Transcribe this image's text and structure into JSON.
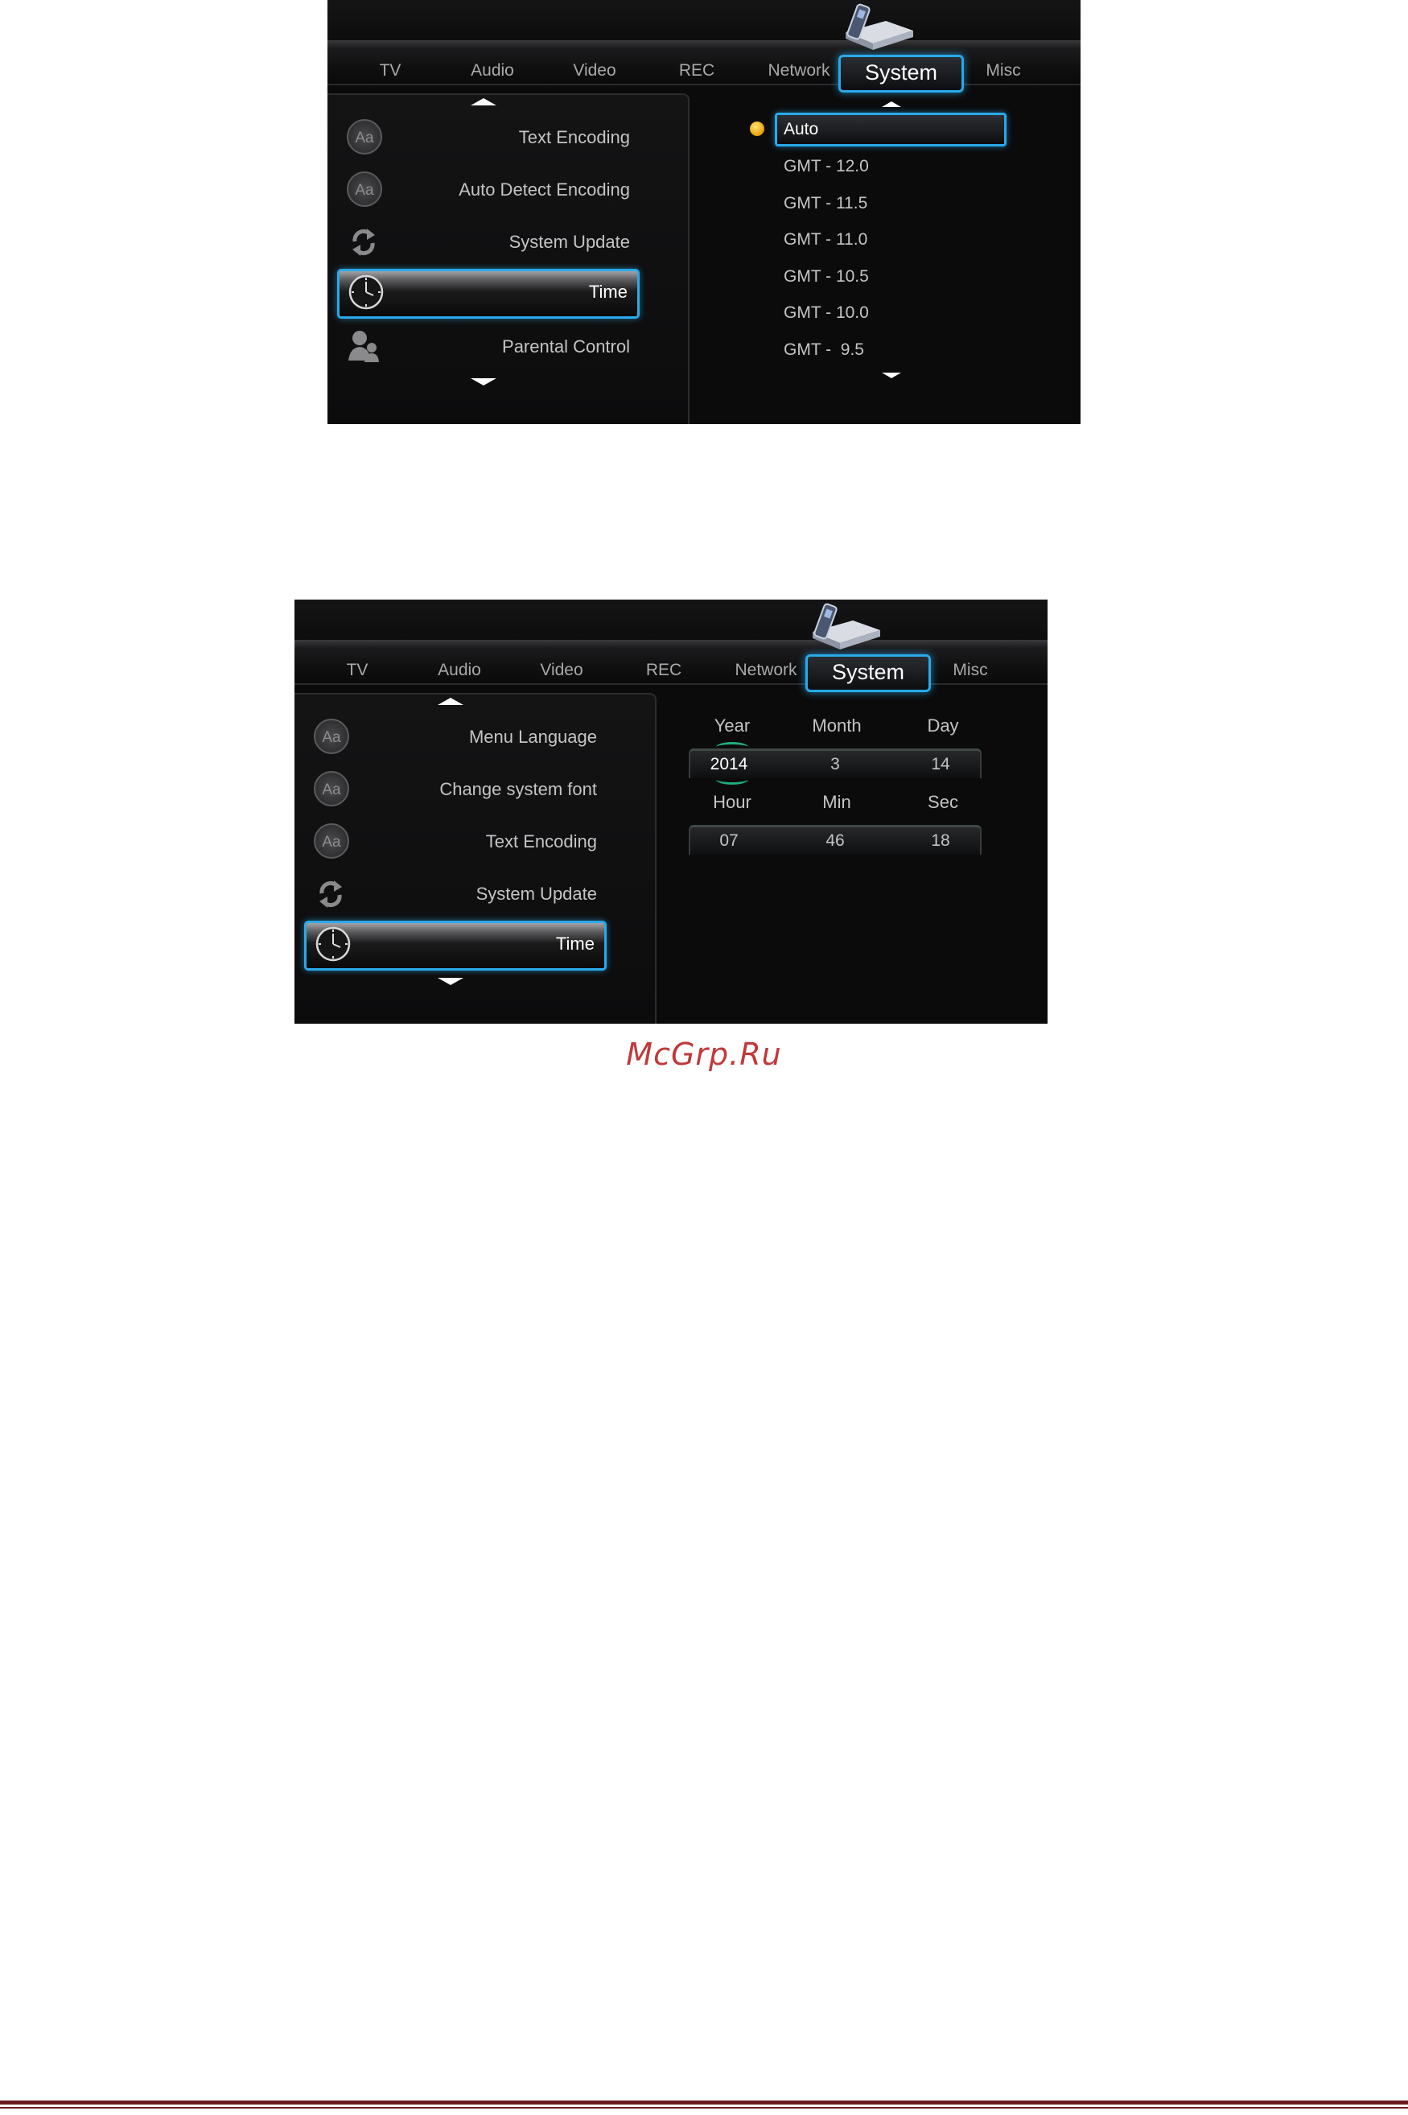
{
  "colors": {
    "accent": "#29a9ea",
    "panel_bg": "#0b0b0c",
    "radio": "#e6a000",
    "watermark": "#c0393b",
    "footer_rule": "#6b1a1f"
  },
  "screen1": {
    "tabs": [
      {
        "label": "TV"
      },
      {
        "label": "Audio"
      },
      {
        "label": "Video"
      },
      {
        "label": "REC"
      },
      {
        "label": "Network"
      },
      {
        "label": "System",
        "active": true
      },
      {
        "label": "Misc"
      }
    ],
    "menu": [
      {
        "label": "Text Encoding",
        "icon": "aa-icon"
      },
      {
        "label": "Auto Detect Encoding",
        "icon": "aa-icon"
      },
      {
        "label": "System Update",
        "icon": "refresh-icon"
      },
      {
        "label": "Time",
        "icon": "clock-icon",
        "selected": true
      },
      {
        "label": "Parental Control",
        "icon": "parental-control-icon"
      }
    ],
    "timezone": {
      "selected": "Auto",
      "options": [
        "GMT - 12.0",
        "GMT - 11.5",
        "GMT - 11.0",
        "GMT - 10.5",
        "GMT - 10.0",
        "GMT -  9.5"
      ]
    }
  },
  "screen2": {
    "tabs": [
      {
        "label": "TV"
      },
      {
        "label": "Audio"
      },
      {
        "label": "Video"
      },
      {
        "label": "REC"
      },
      {
        "label": "Network"
      },
      {
        "label": "System",
        "active": true
      },
      {
        "label": "Misc"
      }
    ],
    "menu": [
      {
        "label": "Menu Language",
        "icon": "aa-icon"
      },
      {
        "label": "Change system font",
        "icon": "aa-icon"
      },
      {
        "label": "Text Encoding",
        "icon": "aa-icon"
      },
      {
        "label": "System Update",
        "icon": "refresh-icon"
      },
      {
        "label": "Time",
        "icon": "clock-icon",
        "selected": true
      }
    ],
    "date": {
      "labels": {
        "year": "Year",
        "month": "Month",
        "day": "Day"
      },
      "values": {
        "year": "2014",
        "month": "3",
        "day": "14"
      }
    },
    "time": {
      "labels": {
        "hour": "Hour",
        "min": "Min",
        "sec": "Sec"
      },
      "values": {
        "hour": "07",
        "min": "46",
        "sec": "18"
      }
    }
  },
  "watermark": "McGrp.Ru"
}
